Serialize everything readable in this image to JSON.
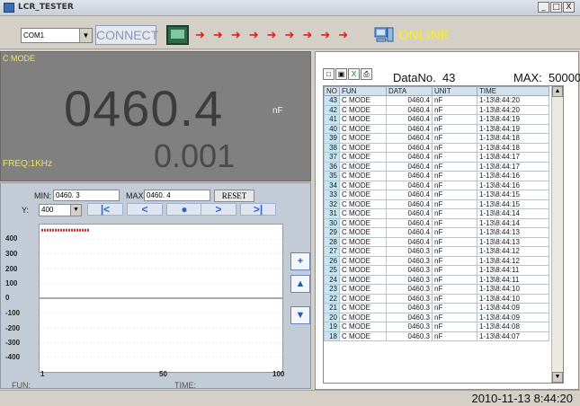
{
  "window": {
    "title": "LCR_TESTER",
    "buttons": [
      "_",
      "□",
      "X"
    ]
  },
  "toolbar": {
    "port_value": "COM1",
    "connect_label": "CONNECT",
    "status_label": "ONLINE",
    "colors": {
      "arrow": "#e02020",
      "online": "#f2e640"
    }
  },
  "display": {
    "mode_label": "C MODE",
    "main_value": "0460.4",
    "unit": "nF",
    "sub_value": "0.001",
    "freq_label": "FREQ:1KHz"
  },
  "graph_controls": {
    "min_label": "MIN:",
    "min_value": "0460. 3",
    "max_label": "MAX:",
    "max_value": "0460. 4",
    "reset_label": "RESET",
    "y_label": "Y:",
    "y_value": "400",
    "nav_buttons": [
      "first",
      "prev",
      "stop",
      "next",
      "last"
    ],
    "y_ticks": [
      "400",
      "300",
      "200",
      "100",
      "0",
      "-100",
      "-200",
      "-300",
      "-400"
    ],
    "x_ticks": [
      "1",
      "50",
      "100"
    ],
    "fun_label": "FUN:",
    "time_label": "TIME:",
    "side_buttons": [
      "zoom-in",
      "scroll-up",
      "scroll-down"
    ]
  },
  "chart_data": {
    "type": "line",
    "x": [
      1,
      21
    ],
    "values": [
      460.4,
      460.4
    ],
    "ylim": [
      -450,
      450
    ],
    "xlim": [
      1,
      100
    ],
    "colors": {
      "series": "#e62a2a"
    }
  },
  "data_panel": {
    "datano_label": "DataNo.",
    "datano_value": "43",
    "max_label": "MAX:",
    "max_value": "50000",
    "columns": [
      "NO",
      "FUN",
      "DATA",
      "UNIT",
      "TIME"
    ],
    "rows": [
      [
        "43",
        "C MODE",
        "0460.4",
        "nF",
        "1-13\\8:44:20"
      ],
      [
        "42",
        "C MODE",
        "0460.4",
        "nF",
        "1-13\\8:44:20"
      ],
      [
        "41",
        "C MODE",
        "0460.4",
        "nF",
        "1-13\\8:44:19"
      ],
      [
        "40",
        "C MODE",
        "0460.4",
        "nF",
        "1-13\\8:44:19"
      ],
      [
        "39",
        "C MODE",
        "0460.4",
        "nF",
        "1-13\\8:44:18"
      ],
      [
        "38",
        "C MODE",
        "0460.4",
        "nF",
        "1-13\\8:44:18"
      ],
      [
        "37",
        "C MODE",
        "0460.4",
        "nF",
        "1-13\\8:44:17"
      ],
      [
        "36",
        "C MODE",
        "0460.4",
        "nF",
        "1-13\\8:44:17"
      ],
      [
        "35",
        "C MODE",
        "0460.4",
        "nF",
        "1-13\\8:44:16"
      ],
      [
        "34",
        "C MODE",
        "0460.4",
        "nF",
        "1-13\\8:44:16"
      ],
      [
        "33",
        "C MODE",
        "0460.4",
        "nF",
        "1-13\\8:44:15"
      ],
      [
        "32",
        "C MODE",
        "0460.4",
        "nF",
        "1-13\\8:44:15"
      ],
      [
        "31",
        "C MODE",
        "0460.4",
        "nF",
        "1-13\\8:44:14"
      ],
      [
        "30",
        "C MODE",
        "0460.4",
        "nF",
        "1-13\\8:44:14"
      ],
      [
        "29",
        "C MODE",
        "0460.4",
        "nF",
        "1-13\\8:44:13"
      ],
      [
        "28",
        "C MODE",
        "0460.4",
        "nF",
        "1-13\\8:44:13"
      ],
      [
        "27",
        "C MODE",
        "0460.3",
        "nF",
        "1-13\\8:44:12"
      ],
      [
        "26",
        "C MODE",
        "0460.3",
        "nF",
        "1-13\\8:44:12"
      ],
      [
        "25",
        "C MODE",
        "0460.3",
        "nF",
        "1-13\\8:44:11"
      ],
      [
        "24",
        "C MODE",
        "0460.3",
        "nF",
        "1-13\\8:44:11"
      ],
      [
        "23",
        "C MODE",
        "0460.3",
        "nF",
        "1-13\\8:44:10"
      ],
      [
        "22",
        "C MODE",
        "0460.3",
        "nF",
        "1-13\\8:44:10"
      ],
      [
        "21",
        "C MODE",
        "0460.3",
        "nF",
        "1-13\\8:44:09"
      ],
      [
        "20",
        "C MODE",
        "0460.3",
        "nF",
        "1-13\\8:44:09"
      ],
      [
        "19",
        "C MODE",
        "0460.3",
        "nF",
        "1-13\\8:44:08"
      ],
      [
        "18",
        "C MODE",
        "0460.3",
        "nF",
        "1-13\\8:44:07"
      ]
    ]
  },
  "statusbar": {
    "datetime": "2010-11-13 8:44:20"
  }
}
